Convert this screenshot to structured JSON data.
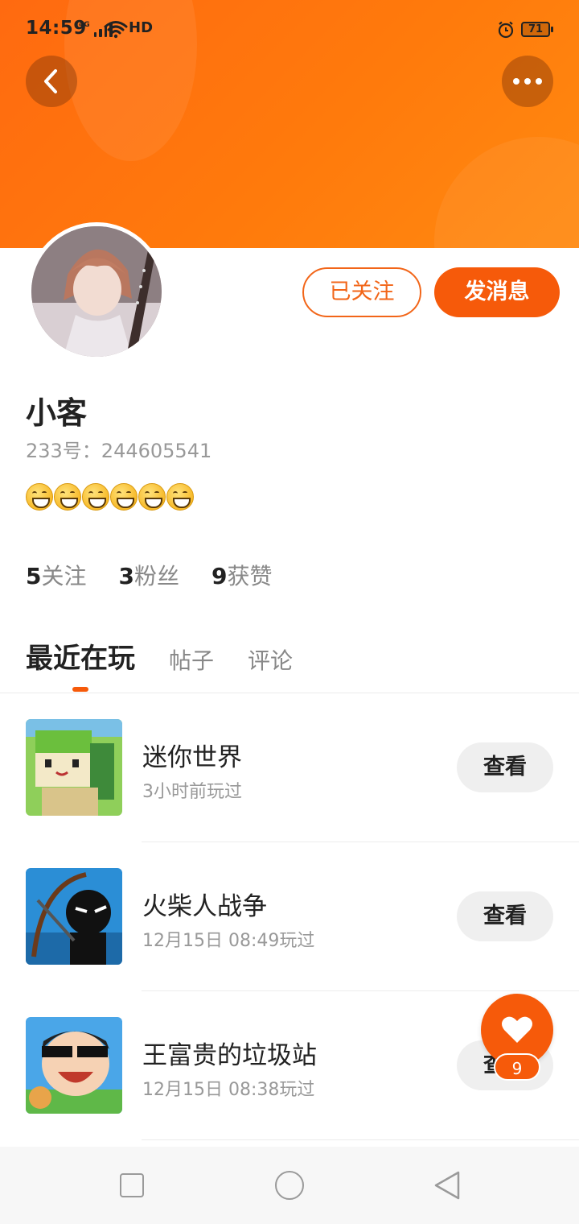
{
  "status_bar": {
    "time": "14:59",
    "network": "4G",
    "hd": "HD",
    "battery": "71"
  },
  "header": {
    "back_icon": "chevron-left-icon",
    "more_icon": "more-dots-icon",
    "accent_color": "#ff6a10"
  },
  "profile": {
    "name": "小客",
    "uid": "233号：244605541",
    "emoji_count": 6,
    "emoji_icon": "grinning-face-icon",
    "followed_label": "已关注",
    "message_label": "发消息"
  },
  "stats": [
    {
      "num": "5",
      "label": "关注"
    },
    {
      "num": "3",
      "label": "粉丝"
    },
    {
      "num": "9",
      "label": "获赞"
    }
  ],
  "tabs": [
    {
      "label": "最近在玩",
      "active": true
    },
    {
      "label": "帖子",
      "active": false
    },
    {
      "label": "评论",
      "active": false
    }
  ],
  "games": [
    {
      "title": "迷你世界",
      "time": "3小时前玩过",
      "button": "查看"
    },
    {
      "title": "火柴人战争",
      "time": "12月15日 08:49玩过",
      "button": "查看"
    },
    {
      "title": "王富贵的垃圾站",
      "time": "12月15日 08:38玩过",
      "button": "查看"
    }
  ],
  "like_fab": {
    "icon": "heart-icon",
    "count": "9"
  },
  "nav": {
    "recent_icon": "square-icon",
    "home_icon": "circle-icon",
    "back_icon": "triangle-back-icon"
  }
}
